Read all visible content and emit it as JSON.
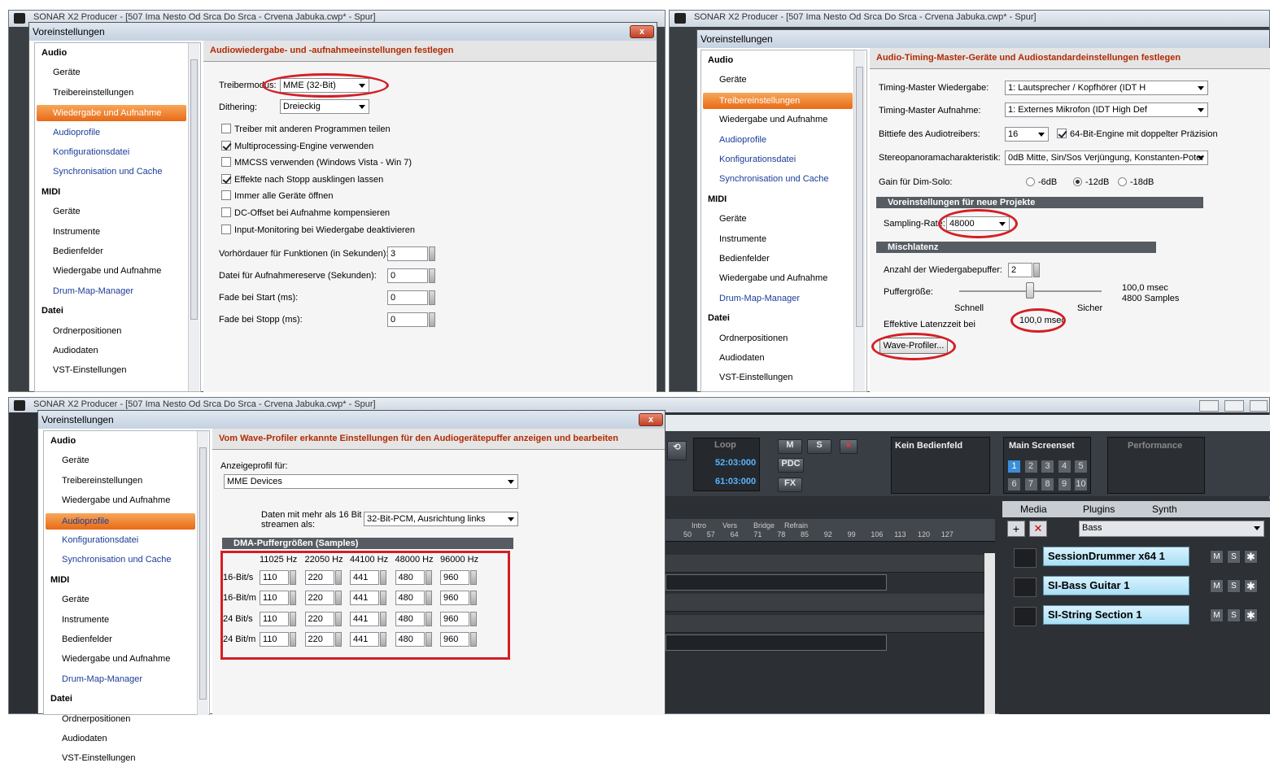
{
  "daw_title": "SONAR X2 Producer - [507 Ima Nesto Od Srca Do Srca - Crvena Jabuka.cwp* - Spur]",
  "dialog_title": "Voreinstellungen",
  "close": "x",
  "tree": [
    {
      "k": "cat",
      "t": "Audio"
    },
    {
      "k": "it",
      "t": "Geräte"
    },
    {
      "k": "it",
      "t": "Treibereinstellungen"
    },
    {
      "k": "it",
      "t": "Wiedergabe und Aufnahme"
    },
    {
      "k": "lnk",
      "t": "Audioprofile"
    },
    {
      "k": "lnk",
      "t": "Konfigurationsdatei"
    },
    {
      "k": "lnk",
      "t": "Synchronisation und Cache"
    },
    {
      "k": "cat",
      "t": "MIDI"
    },
    {
      "k": "it",
      "t": "Geräte"
    },
    {
      "k": "it",
      "t": "Instrumente"
    },
    {
      "k": "it",
      "t": "Bedienfelder"
    },
    {
      "k": "it",
      "t": "Wiedergabe und Aufnahme"
    },
    {
      "k": "lnk",
      "t": "Drum-Map-Manager"
    },
    {
      "k": "cat",
      "t": "Datei"
    },
    {
      "k": "it",
      "t": "Ordnerpositionen"
    },
    {
      "k": "it",
      "t": "Audiodaten"
    },
    {
      "k": "it",
      "t": "VST-Einstellungen"
    }
  ],
  "d1": {
    "header": "Audiowiedergabe- und -aufnahmeeinstellungen festlegen",
    "treiber_label": "Treibermodus:",
    "treiber_value": "MME (32-Bit)",
    "dither_label": "Dithering:",
    "dither_value": "Dreieckig",
    "checks": [
      {
        "label": "Treiber mit anderen Programmen teilen",
        "on": false
      },
      {
        "label": "Multiprocessing-Engine verwenden",
        "on": true
      },
      {
        "label": "MMCSS verwenden (Windows Vista - Win 7)",
        "on": false
      },
      {
        "label": "Effekte nach Stopp ausklingen lassen",
        "on": true
      },
      {
        "label": "Immer alle Geräte öffnen",
        "on": false
      },
      {
        "label": "DC-Offset bei Aufnahme kompensieren",
        "on": false
      },
      {
        "label": "Input-Monitoring bei Wiedergabe deaktivieren",
        "on": false
      }
    ],
    "spins": [
      {
        "label": "Vorhördauer für Funktionen (in Sekunden):",
        "value": "3"
      },
      {
        "label": "Datei für Aufnahmereserve (Sekunden):",
        "value": "0"
      },
      {
        "label": "Fade bei Start (ms):",
        "value": "0"
      },
      {
        "label": "Fade bei Stopp (ms):",
        "value": "0"
      }
    ]
  },
  "d2": {
    "header": "Audio-Timing-Master-Geräte und Audiostandardeinstellungen festlegen",
    "tm_play_label": "Timing-Master Wiedergabe:",
    "tm_play_value": "1: Lautsprecher / Kopfhörer (IDT H",
    "tm_rec_label": "Timing-Master Aufnahme:",
    "tm_rec_value": "1: Externes Mikrofon (IDT High Def",
    "bit_label": "Bittiefe des Audiotreibers:",
    "bit_value": "16",
    "engine_label": "64-Bit-Engine mit doppelter Präzision",
    "stereo_label": "Stereopanoramacharakteristik:",
    "stereo_value": "0dB Mitte, Sin/Sos Verjüngung, Konstanten-Poter",
    "gain_label": "Gain für Dim-Solo:",
    "gain_opts": [
      "-6dB",
      "-12dB",
      "-18dB"
    ],
    "sect_new": "Voreinstellungen für neue Projekte",
    "rate_label": "Sampling-Rate:",
    "rate_value": "48000",
    "sect_mix": "Mischlatenz",
    "buffers_label": "Anzahl der Wiedergabepuffer:",
    "buffers_value": "2",
    "bufsize_label": "Puffergröße:",
    "bufsize_msec": "100,0 msec",
    "bufsize_samples": "4800 Samples",
    "fast": "Schnell",
    "safe": "Sicher",
    "latency_label": "Effektive Latenzzeit bei",
    "latency_value": "100,0 msec",
    "wave_btn": "Wave-Profiler..."
  },
  "d3": {
    "header": "Vom Wave-Profiler erkannte Einstellungen für den Audiogerätepuffer anzeigen und bearbeiten",
    "profile_label": "Anzeigeprofil für:",
    "profile_value": "MME Devices",
    "stream_label1": "Daten mit mehr als 16 Bit",
    "stream_label2": "streamen als:",
    "stream_value": "32-Bit-PCM, Ausrichtung links",
    "dma_header": "DMA-Puffergrößen (Samples)",
    "cols": [
      "11025 Hz",
      "22050 Hz",
      "44100 Hz",
      "48000 Hz",
      "96000 Hz"
    ],
    "rows": [
      {
        "label": "16-Bit/s",
        "vals": [
          "110",
          "220",
          "441",
          "480",
          "960"
        ]
      },
      {
        "label": "16-Bit/m",
        "vals": [
          "110",
          "220",
          "441",
          "480",
          "960"
        ]
      },
      {
        "label": "24 Bit/s",
        "vals": [
          "110",
          "220",
          "441",
          "480",
          "960"
        ]
      },
      {
        "label": "24 Bit/m",
        "vals": [
          "110",
          "220",
          "441",
          "480",
          "960"
        ]
      }
    ]
  },
  "daw": {
    "loop": "Loop",
    "time1": "52:03:000",
    "time2": "61:03:000",
    "m": "M",
    "s": "S",
    "pdc": "PDC",
    "fx": "FX",
    "kein": "Kein Bedienfeld",
    "main": "Main Screenset",
    "perf": "Performance",
    "nums": [
      "1",
      "2",
      "3",
      "4",
      "5",
      "6",
      "7",
      "8",
      "9",
      "10"
    ],
    "ruler_marks": [
      "Intro",
      "Vers",
      "Bridge",
      "Refrain"
    ],
    "ruler_nums": [
      "50",
      "57",
      "64",
      "71",
      "78",
      "85",
      "92",
      "99",
      "106",
      "113",
      "120",
      "127"
    ],
    "tabs": [
      "Media",
      "Plugins",
      "Synth"
    ],
    "search": "Bass",
    "plugins": [
      "SessionDrummer x64 1",
      "SI-Bass Guitar 1",
      "SI-String Section 1"
    ]
  }
}
